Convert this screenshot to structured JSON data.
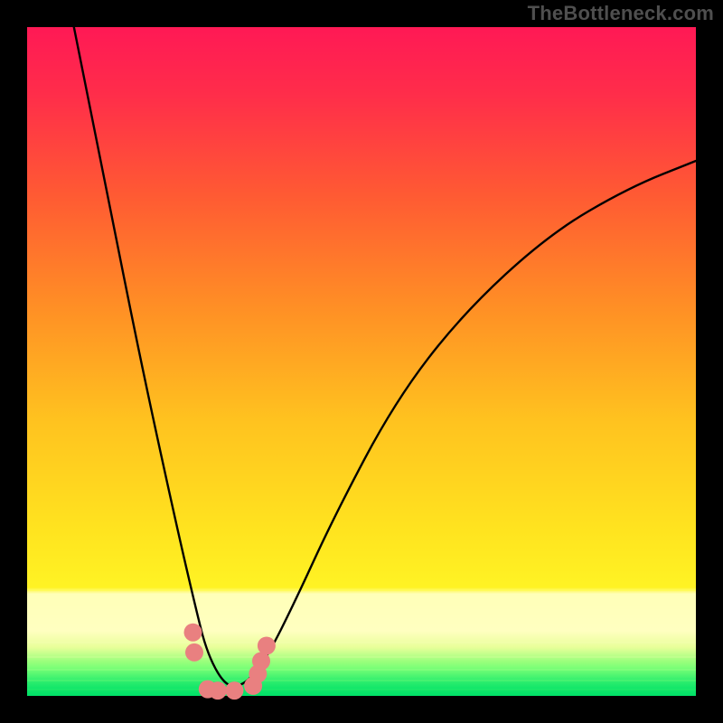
{
  "attribution": "TheBottleneck.com",
  "chart_data": {
    "type": "line",
    "title": "",
    "xlabel": "",
    "ylabel": "",
    "xlim": [
      0,
      1
    ],
    "ylim": [
      0,
      1
    ],
    "series": [
      {
        "name": "curve",
        "notes": "V-shaped curve: steep descent on left, minimum near x≈0.30, rising right branch approaching the top-right. Values are normalized 0–1 from the plot area.",
        "x": [
          0.07,
          0.12,
          0.17,
          0.22,
          0.25,
          0.27,
          0.3,
          0.33,
          0.36,
          0.4,
          0.46,
          0.55,
          0.65,
          0.78,
          0.9,
          1.0
        ],
        "y": [
          1.0,
          0.75,
          0.5,
          0.27,
          0.14,
          0.06,
          0.01,
          0.02,
          0.06,
          0.14,
          0.27,
          0.44,
          0.57,
          0.69,
          0.76,
          0.8
        ]
      },
      {
        "name": "markers",
        "notes": "Salmon-colored rounded markers clustered near the curve minimum.",
        "x": [
          0.248,
          0.25,
          0.27,
          0.285,
          0.31,
          0.338,
          0.345,
          0.35,
          0.358
        ],
        "y": [
          0.095,
          0.065,
          0.01,
          0.008,
          0.008,
          0.015,
          0.033,
          0.052,
          0.075
        ]
      }
    ],
    "background_gradient": {
      "top": "#ff1850",
      "mid1": "#ff6f2c",
      "mid2": "#ffd21f",
      "band": "#ffffbf",
      "bottom": "#00e46a"
    },
    "frame_color": "#000000",
    "marker_color": "#e98080",
    "curve_color": "#000000"
  }
}
